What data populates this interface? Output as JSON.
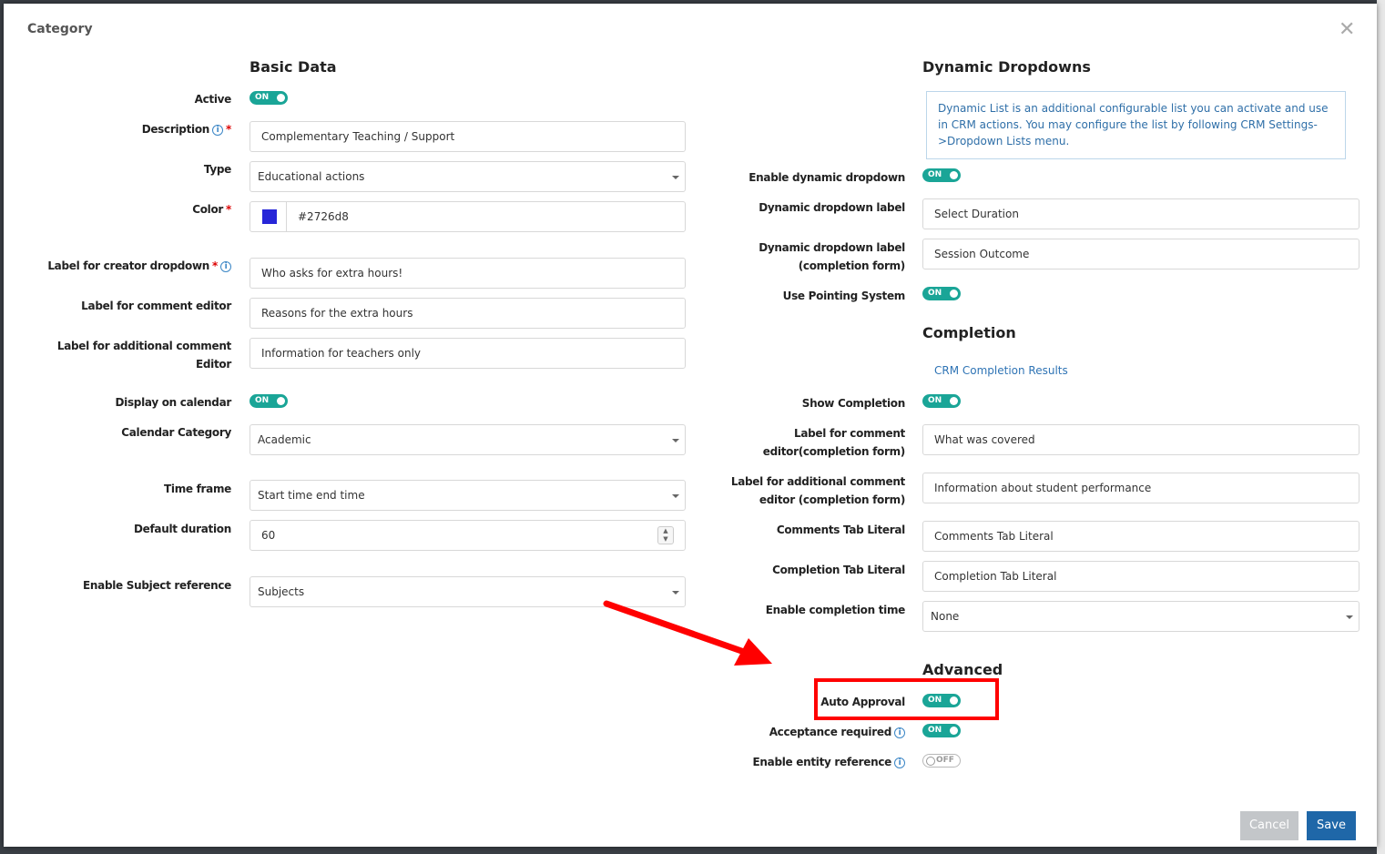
{
  "modal": {
    "title": "Category"
  },
  "basic": {
    "title": "Basic Data",
    "active_label": "Active",
    "description_label": "Description",
    "description_value": "Complementary Teaching / Support",
    "type_label": "Type",
    "type_value": "Educational actions",
    "color_label": "Color",
    "color_value": "#2726d8",
    "creator_label": "Label for creator dropdown",
    "creator_value": "Who asks for extra hours!",
    "comment_label": "Label for comment editor",
    "comment_value": "Reasons for the extra hours",
    "addcomment_label": "Label for additional comment Editor",
    "addcomment_value": "Information for teachers only",
    "display_cal_label": "Display on calendar",
    "cal_category_label": "Calendar Category",
    "cal_category_value": "Academic",
    "timeframe_label": "Time frame",
    "timeframe_value": "Start time end time",
    "duration_label": "Default duration",
    "duration_value": "60",
    "subject_label": "Enable Subject reference",
    "subject_value": "Subjects"
  },
  "dynamic": {
    "title": "Dynamic Dropdowns",
    "info": "Dynamic List is an additional configurable list you can activate and use in CRM actions. You may configure the list by following CRM Settings->Dropdown Lists menu.",
    "enable_label": "Enable dynamic dropdown",
    "label_label": "Dynamic dropdown label",
    "label_value": "Select Duration",
    "label_completion_label": "Dynamic dropdown label (completion form)",
    "label_completion_value": "Session Outcome",
    "pointing_label": "Use Pointing System"
  },
  "completion": {
    "title": "Completion",
    "link": "CRM Completion Results",
    "show_label": "Show Completion",
    "comment_label": "Label for comment editor(completion form)",
    "comment_value": "What was covered",
    "addcomment_label": "Label for additional comment editor (completion form)",
    "addcomment_value": "Information about student performance",
    "comments_tab_label": "Comments Tab Literal",
    "comments_tab_value": "Comments Tab Literal",
    "completion_tab_label": "Completion Tab Literal",
    "completion_tab_value": "Completion Tab Literal",
    "time_label": "Enable completion time",
    "time_value": "None"
  },
  "advanced": {
    "title": "Advanced",
    "auto_label": "Auto Approval",
    "acceptance_label": "Acceptance required",
    "entity_label": "Enable entity reference"
  },
  "toggles": {
    "on": "ON",
    "off": "OFF"
  },
  "buttons": {
    "cancel": "Cancel",
    "save": "Save"
  },
  "colors": {
    "accent": "#1aa597",
    "primary": "#1f67a8",
    "swatch": "#2726d8",
    "annotation": "#ff0000"
  }
}
